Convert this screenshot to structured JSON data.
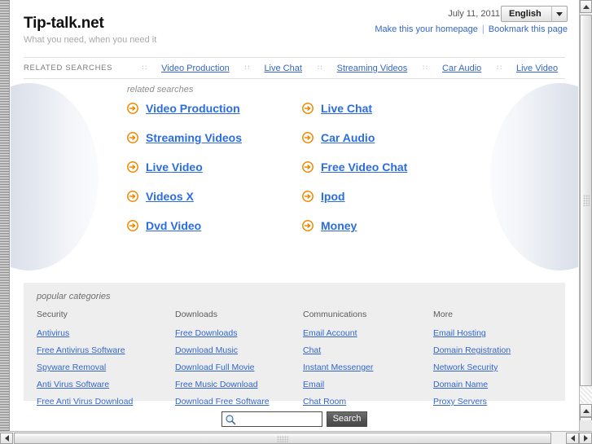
{
  "header": {
    "site_title": "Tip-talk.net",
    "tagline": "What you need, when you need it",
    "date": "July 11, 2011",
    "language": "English",
    "make_homepage": "Make this your homepage",
    "bookmark": "Bookmark this page",
    "links_divider": "|"
  },
  "relnav": {
    "label": "RELATED SEARCHES",
    "separator": "::",
    "items": [
      {
        "label": "Video Production"
      },
      {
        "label": "Live Chat"
      },
      {
        "label": "Streaming Videos"
      },
      {
        "label": "Car Audio"
      },
      {
        "label": "Live Video"
      }
    ]
  },
  "hero": {
    "caption": "related searches",
    "items": [
      {
        "label": "Video Production"
      },
      {
        "label": "Live Chat"
      },
      {
        "label": "Streaming Videos"
      },
      {
        "label": "Car Audio"
      },
      {
        "label": "Live Video"
      },
      {
        "label": "Free Video Chat"
      },
      {
        "label": "Videos X"
      },
      {
        "label": "Ipod"
      },
      {
        "label": "Dvd Video"
      },
      {
        "label": "Money"
      }
    ]
  },
  "popular": {
    "caption": "popular categories",
    "columns": [
      {
        "heading": "Security",
        "links": [
          "Antivirus",
          "Free Antivirus Software",
          "Spyware Removal",
          "Anti Virus Software",
          "Free Anti Virus Download"
        ]
      },
      {
        "heading": "Downloads",
        "links": [
          "Free Downloads",
          "Download Music",
          "Download Full Movie",
          "Free Music Download",
          "Download Free Software"
        ]
      },
      {
        "heading": "Communications",
        "links": [
          "Email Account",
          "Chat",
          "Instant Messenger",
          "Email",
          "Chat Room"
        ]
      },
      {
        "heading": "More",
        "links": [
          "Email Hosting",
          "Domain Registration",
          "Network Security",
          "Domain Name",
          "Proxy Servers"
        ]
      }
    ]
  },
  "search": {
    "value": "",
    "placeholder": "",
    "button_label": "Search",
    "icon": "magnifier-icon"
  },
  "colors": {
    "link_blue": "#3366cc",
    "hero_link_blue": "#2b6ce0",
    "arrow_orange": "#ee8800",
    "panel_gray": "#eeeeee",
    "title_black": "#111111"
  }
}
